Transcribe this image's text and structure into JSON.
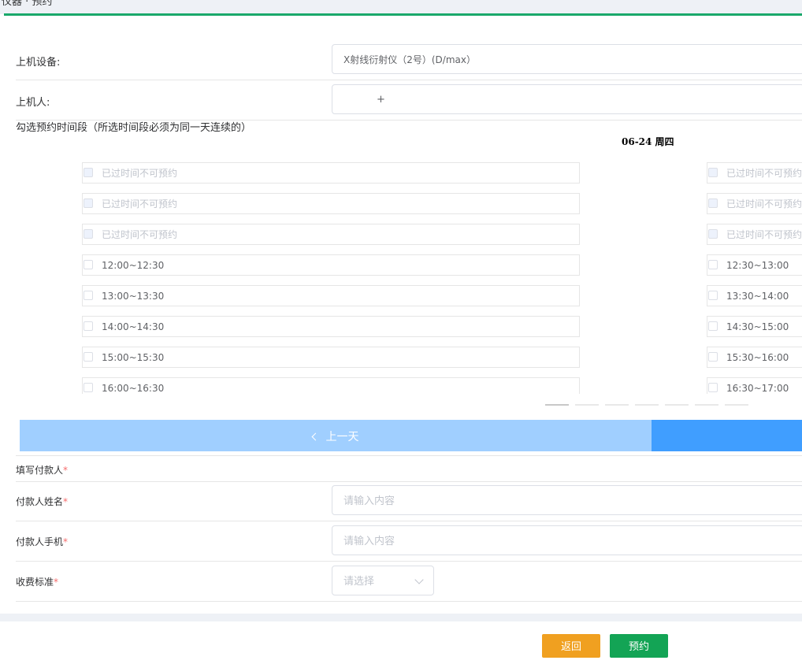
{
  "breadcrumb": "仪器 · 预约",
  "device": {
    "label": "上机设备:",
    "value": "X射线衍射仪（2号）(D/max）"
  },
  "operator": {
    "label": "上机人:",
    "add_symbol": "+"
  },
  "slot_section": {
    "title": "勾选预约时间段（所选时间段必须为同一天连续的）",
    "date": "06-24 周四",
    "left_column": [
      {
        "label": "已过时间不可预约",
        "disabled": true
      },
      {
        "label": "已过时间不可预约",
        "disabled": true
      },
      {
        "label": "已过时间不可预约",
        "disabled": true
      },
      {
        "label": "12:00~12:30",
        "disabled": false
      },
      {
        "label": "13:00~13:30",
        "disabled": false
      },
      {
        "label": "14:00~14:30",
        "disabled": false
      },
      {
        "label": "15:00~15:30",
        "disabled": false
      },
      {
        "label": "16:00~16:30",
        "disabled": false
      }
    ],
    "right_column": [
      {
        "label": "已过时间不可预约",
        "disabled": true
      },
      {
        "label": "已过时间不可预约",
        "disabled": true
      },
      {
        "label": "已过时间不可预约",
        "disabled": true
      },
      {
        "label": "12:30~13:00",
        "disabled": false
      },
      {
        "label": "13:30~14:00",
        "disabled": false
      },
      {
        "label": "14:30~15:00",
        "disabled": false
      },
      {
        "label": "15:30~16:00",
        "disabled": false
      },
      {
        "label": "16:30~17:00",
        "disabled": false
      }
    ],
    "page_count": 7,
    "active_page": 1
  },
  "day_nav": {
    "prev_label": "上一天",
    "prev_icon": "chevron-left-icon"
  },
  "payer": {
    "section_label": "填写付款人",
    "name_label": "付款人姓名",
    "name_placeholder": "请输入内容",
    "phone_label": "付款人手机",
    "phone_placeholder": "请输入内容",
    "fee_label": "收费标准",
    "fee_placeholder": "请选择",
    "required_mark": "*"
  },
  "actions": {
    "back": "返回",
    "book": "预约"
  },
  "colors": {
    "accent_green": "#13a455",
    "warning_orange": "#f0a020",
    "primary_blue": "#409eff",
    "required_red": "#f56c6c"
  }
}
